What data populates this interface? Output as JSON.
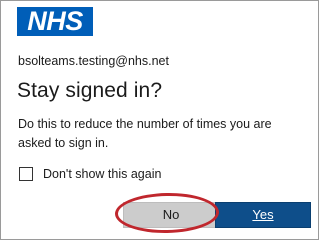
{
  "colors": {
    "brand": "#005eb8",
    "primary_button": "#0e4e8a",
    "secondary_button": "#cccccc",
    "highlight": "#c0272d"
  },
  "logo": {
    "text": "NHS"
  },
  "account": {
    "email": "bsolteams.testing@nhs.net"
  },
  "dialog": {
    "title": "Stay signed in?",
    "description": "Do this to reduce the number of times you are asked to sign in.",
    "checkbox_label": "Don't show this again",
    "checkbox_checked": false
  },
  "buttons": {
    "no_label": "No",
    "yes_label": "Yes"
  },
  "annotation": {
    "highlight_target": "No button",
    "shape": "red ellipse"
  }
}
